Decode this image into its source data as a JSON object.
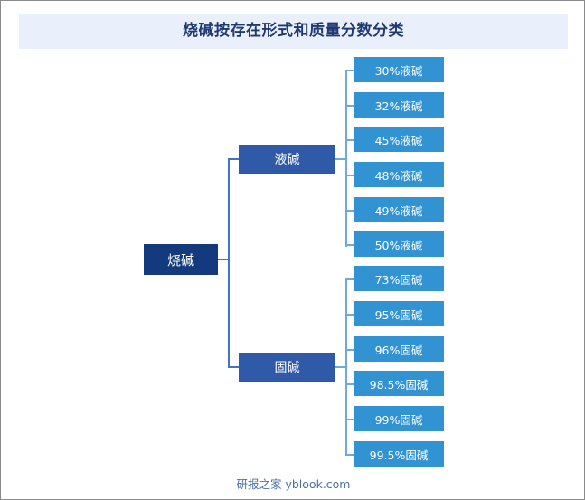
{
  "title": "烧碱按存在形式和质量分数分类",
  "footer": "研报之家 yblook.com",
  "colors": {
    "title_band": "#eaf0fb",
    "title_text": "#1f3a72",
    "root_node": "#123a7d",
    "branch_node": "#2f5aa8",
    "leaf_node": "#3293d2",
    "connector_dark": "#4472c4",
    "connector_light": "#6fa9dc",
    "footer_text": "#4a6fa5",
    "page_border": "#8a8a8a"
  },
  "diagram": {
    "type": "tree",
    "orientation": "left-to-right",
    "root": {
      "label": "烧碱"
    },
    "branches": [
      {
        "label": "液碱",
        "leaves": [
          {
            "label": "30%液碱"
          },
          {
            "label": "32%液碱"
          },
          {
            "label": "45%液碱"
          },
          {
            "label": "48%液碱"
          },
          {
            "label": "49%液碱"
          },
          {
            "label": "50%液碱"
          }
        ]
      },
      {
        "label": "固碱",
        "leaves": [
          {
            "label": "73%固碱"
          },
          {
            "label": "95%固碱"
          },
          {
            "label": "96%固碱"
          },
          {
            "label": "98.5%固碱"
          },
          {
            "label": "99%固碱"
          },
          {
            "label": "99.5%固碱"
          }
        ]
      }
    ]
  }
}
